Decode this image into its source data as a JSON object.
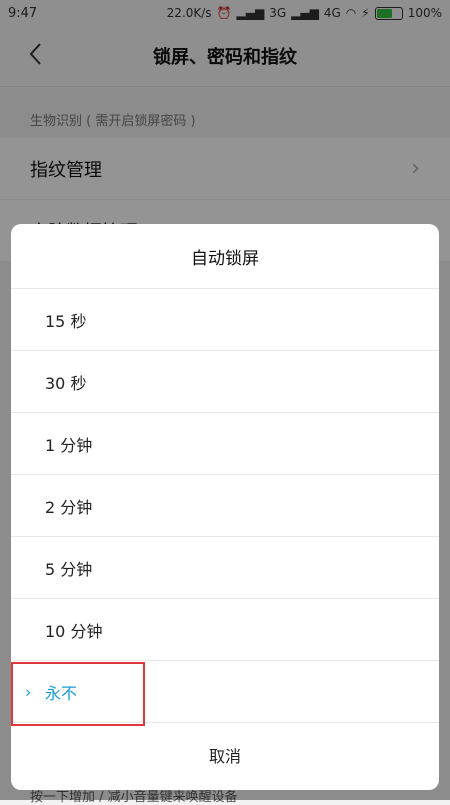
{
  "status_bar": {
    "time": "9:47",
    "speed": "22.0K/s",
    "network1": "3G",
    "network2": "4G",
    "battery_text": "100%"
  },
  "header": {
    "title": "锁屏、密码和指纹",
    "back_icon": "chevron-left-icon"
  },
  "background": {
    "section_label": "生物识别 ( 需开启锁屏密码 )",
    "rows": [
      {
        "label": "指纹管理"
      },
      {
        "label": "人脸数据管理"
      }
    ],
    "bottom_text": "按一下增加 / 减小音量键来唤醒设备"
  },
  "dialog": {
    "title": "自动锁屏",
    "options": [
      {
        "label": "15 秒"
      },
      {
        "label": "30 秒"
      },
      {
        "label": "1 分钟"
      },
      {
        "label": "2 分钟"
      },
      {
        "label": "5 分钟"
      },
      {
        "label": "10 分钟"
      },
      {
        "label": "永不"
      }
    ],
    "selected_index": 6,
    "cancel_label": "取消"
  },
  "colors": {
    "accent": "#1a9bd7",
    "highlight": "#e0383c"
  }
}
